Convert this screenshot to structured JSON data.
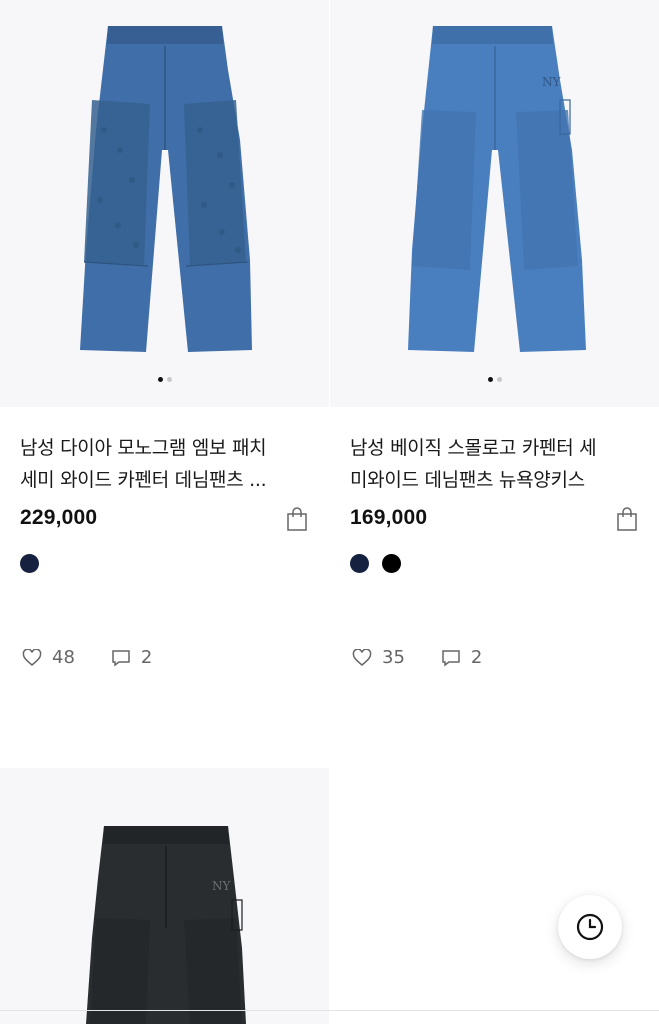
{
  "products": [
    {
      "title_line1": "남성 다이아 모노그램 엠보 패치",
      "title_line2": "세미 와이드 카펜터 데님팬츠 ...",
      "price": "229,000",
      "colors": [
        "#16213f"
      ],
      "likes": "48",
      "comments": "2",
      "image_pages": 2,
      "active_page": 1,
      "denim_color": "#3f6ea8"
    },
    {
      "title_line1": "남성 베이직 스몰로고 카펜터 세",
      "title_line2": "미와이드 데님팬츠 뉴욕양키스",
      "price": "169,000",
      "colors": [
        "#16213f",
        "#000000"
      ],
      "likes": "35",
      "comments": "2",
      "image_pages": 2,
      "active_page": 1,
      "denim_color": "#4a7fbf"
    },
    {
      "denim_color": "#2a2d2f"
    }
  ],
  "icons": {
    "bag": "shopping-bag-icon",
    "like": "heart-icon",
    "comment": "comment-icon",
    "recent": "clock-icon"
  }
}
